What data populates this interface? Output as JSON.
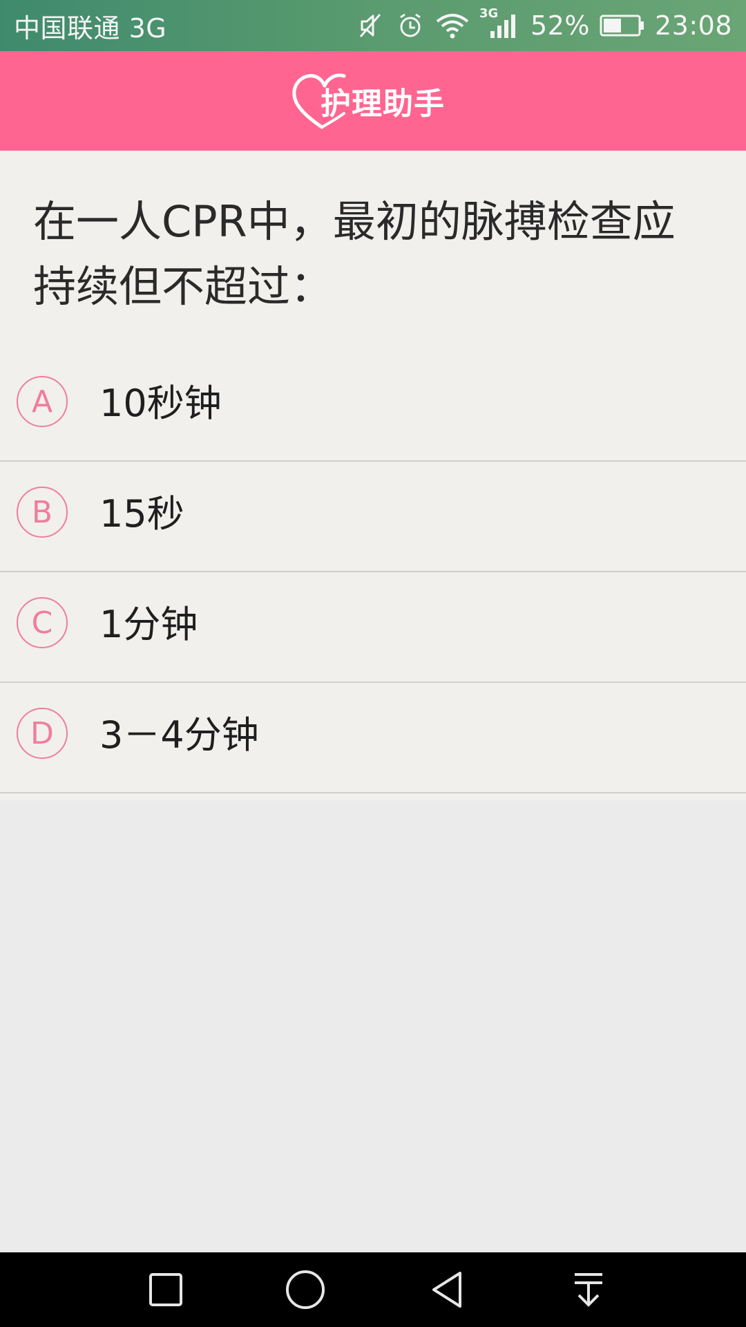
{
  "status_bar": {
    "carrier": "中国联通 3G",
    "network_label": "3G",
    "battery_percent": "52%",
    "battery_level": 0.52,
    "time": "23:08"
  },
  "app": {
    "title": "护理助手",
    "header_color": "#ff6590"
  },
  "question": {
    "text": "在一人CPR中，最初的脉搏检查应持续但不超过：",
    "options": [
      {
        "letter": "A",
        "text": "10秒钟"
      },
      {
        "letter": "B",
        "text": "15秒"
      },
      {
        "letter": "C",
        "text": "1分钟"
      },
      {
        "letter": "D",
        "text": "3－4分钟"
      }
    ]
  },
  "nav_bar": {
    "buttons": [
      "recents-square-icon",
      "home-circle-icon",
      "back-triangle-icon",
      "notification-pull-icon"
    ]
  }
}
